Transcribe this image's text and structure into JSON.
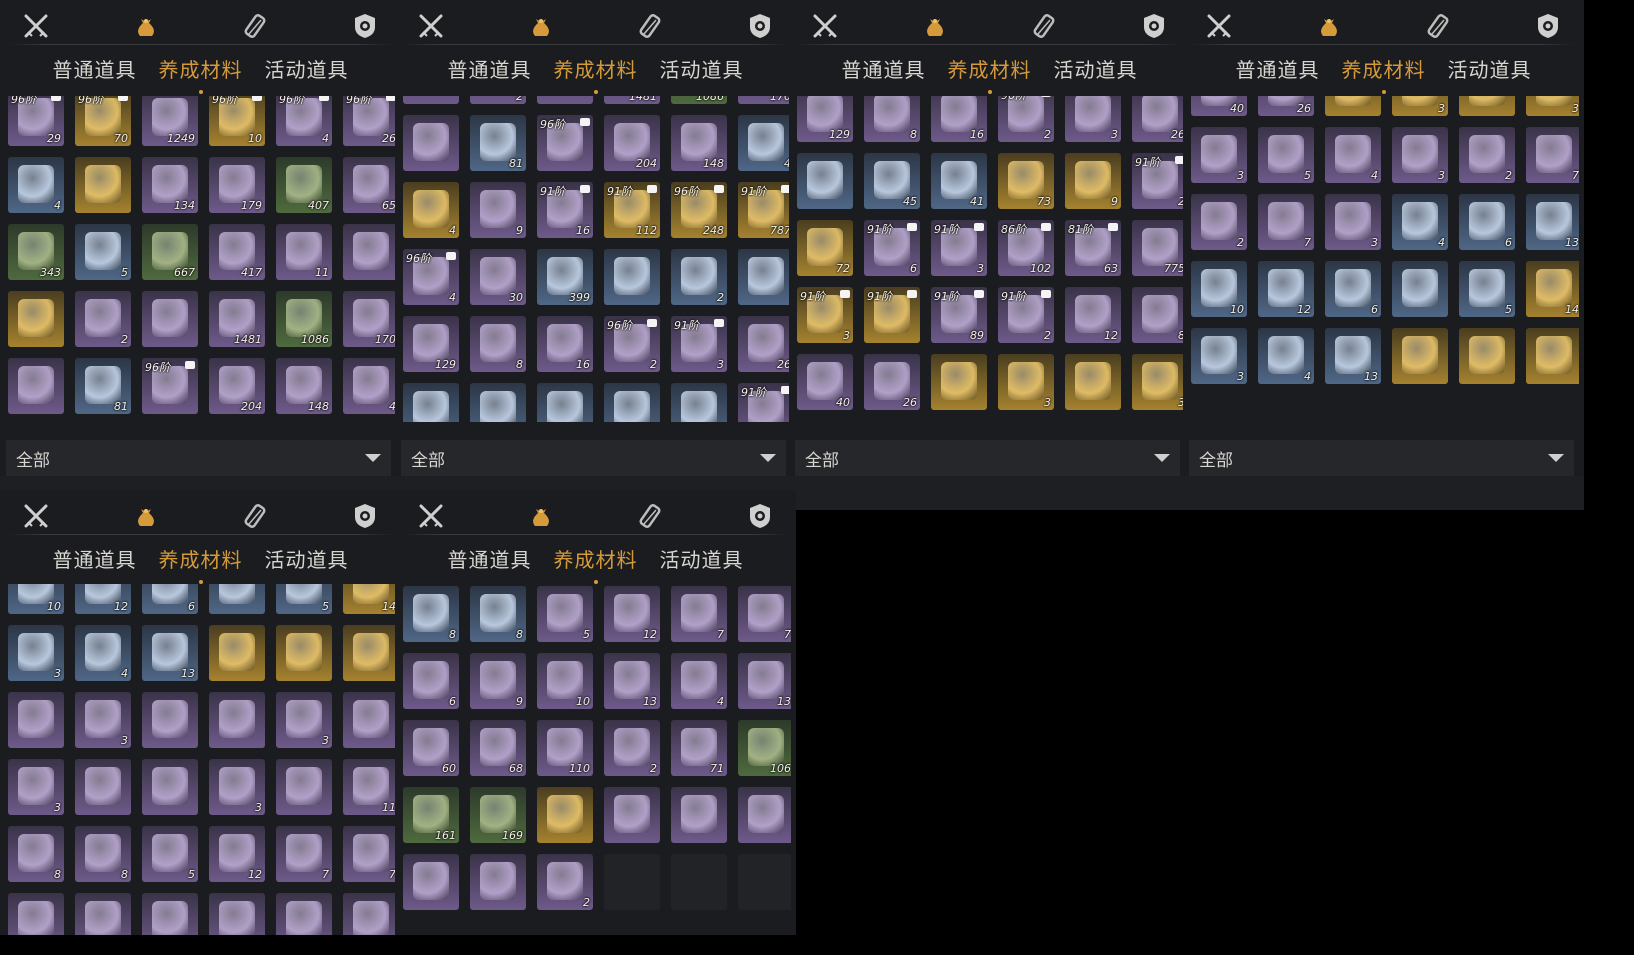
{
  "category_icons": [
    "swords-icon",
    "pouch-icon",
    "scroll-icon",
    "badge-icon"
  ],
  "subtabs": {
    "common": "普通道具",
    "cultivation": "养成材料",
    "event": "活动道具"
  },
  "filter": {
    "label": "全部"
  },
  "colors": {
    "accent": "#d59a3a",
    "panel": "#1b1c1f",
    "text": "#d8d6d0"
  },
  "panels": [
    {
      "rows": [
        [
          {
            "r": "purple",
            "t": "96阶",
            "c": "29"
          },
          {
            "r": "gold",
            "t": "96阶",
            "c": "70"
          },
          {
            "r": "purple",
            "c": "1249"
          },
          {
            "r": "gold",
            "t": "96阶",
            "c": "10"
          },
          {
            "r": "purple",
            "t": "96阶",
            "c": "4"
          },
          {
            "r": "purple",
            "t": "96阶",
            "c": "26"
          }
        ],
        [
          {
            "r": "blue",
            "c": "4"
          },
          {
            "r": "gold",
            "c": ""
          },
          {
            "r": "purple",
            "c": "134"
          },
          {
            "r": "purple",
            "c": "179"
          },
          {
            "r": "green",
            "c": "407"
          },
          {
            "r": "purple",
            "c": "65"
          }
        ],
        [
          {
            "r": "green",
            "c": "343"
          },
          {
            "r": "blue",
            "c": "5"
          },
          {
            "r": "green",
            "c": "667"
          },
          {
            "r": "purple",
            "c": "417"
          },
          {
            "r": "purple",
            "c": "11"
          },
          {
            "r": "purple",
            "c": ""
          }
        ],
        [
          {
            "r": "gold",
            "c": ""
          },
          {
            "r": "purple",
            "c": "2"
          },
          {
            "r": "purple",
            "c": ""
          },
          {
            "r": "purple",
            "c": "1481"
          },
          {
            "r": "green",
            "c": "1086"
          },
          {
            "r": "purple",
            "c": "170"
          }
        ],
        [
          {
            "r": "purple",
            "c": ""
          },
          {
            "r": "blue",
            "c": "81"
          },
          {
            "r": "purple",
            "t": "96阶",
            "c": ""
          },
          {
            "r": "purple",
            "c": "204"
          },
          {
            "r": "purple",
            "c": "148"
          },
          {
            "r": "purple",
            "c": "4"
          }
        ]
      ]
    },
    {
      "rows": [
        [
          {
            "r": "purple",
            "c": ""
          },
          {
            "r": "purple",
            "c": "2"
          },
          {
            "r": "purple",
            "c": ""
          },
          {
            "r": "purple",
            "c": "1481"
          },
          {
            "r": "green",
            "c": "1086"
          },
          {
            "r": "purple",
            "c": "170"
          }
        ],
        [
          {
            "r": "purple",
            "c": ""
          },
          {
            "r": "blue",
            "c": "81"
          },
          {
            "r": "purple",
            "t": "96阶",
            "c": ""
          },
          {
            "r": "purple",
            "c": "204"
          },
          {
            "r": "purple",
            "c": "148"
          },
          {
            "r": "blue",
            "c": "4"
          }
        ],
        [
          {
            "r": "gold",
            "c": "4"
          },
          {
            "r": "purple",
            "c": "9"
          },
          {
            "r": "purple",
            "t": "91阶",
            "c": "16"
          },
          {
            "r": "gold",
            "t": "91阶",
            "c": "112"
          },
          {
            "r": "gold",
            "t": "96阶",
            "c": "248"
          },
          {
            "r": "gold",
            "t": "91阶",
            "c": "787"
          }
        ],
        [
          {
            "r": "purple",
            "t": "96阶",
            "c": "4"
          },
          {
            "r": "purple",
            "c": "30"
          },
          {
            "r": "blue",
            "c": "399"
          },
          {
            "r": "blue",
            "c": ""
          },
          {
            "r": "blue",
            "c": "2"
          },
          {
            "r": "blue",
            "c": ""
          }
        ],
        [
          {
            "r": "purple",
            "c": "129"
          },
          {
            "r": "purple",
            "c": "8"
          },
          {
            "r": "purple",
            "c": "16"
          },
          {
            "r": "purple",
            "t": "96阶",
            "c": "2"
          },
          {
            "r": "purple",
            "t": "91阶",
            "c": "3"
          },
          {
            "r": "purple",
            "c": "26"
          }
        ],
        [
          {
            "r": "blue",
            "c": ""
          },
          {
            "r": "blue",
            "c": "45"
          },
          {
            "r": "blue",
            "c": "41"
          },
          {
            "r": "blue",
            "c": "73"
          },
          {
            "r": "blue",
            "c": "9"
          },
          {
            "r": "purple",
            "t": "91阶",
            "c": "2"
          }
        ]
      ]
    },
    {
      "rows": [
        [
          {
            "r": "purple",
            "c": "129"
          },
          {
            "r": "purple",
            "c": "8"
          },
          {
            "r": "purple",
            "c": "16"
          },
          {
            "r": "purple",
            "t": "96阶",
            "c": "2"
          },
          {
            "r": "purple",
            "c": "3"
          },
          {
            "r": "purple",
            "c": "26"
          }
        ],
        [
          {
            "r": "blue",
            "c": ""
          },
          {
            "r": "blue",
            "c": "45"
          },
          {
            "r": "blue",
            "c": "41"
          },
          {
            "r": "gold",
            "c": "73"
          },
          {
            "r": "gold",
            "c": "9"
          },
          {
            "r": "purple",
            "t": "91阶",
            "c": "2"
          }
        ],
        [
          {
            "r": "gold",
            "c": "72"
          },
          {
            "r": "purple",
            "t": "91阶",
            "c": "6"
          },
          {
            "r": "purple",
            "t": "91阶",
            "c": "3"
          },
          {
            "r": "purple",
            "t": "86阶",
            "c": "102"
          },
          {
            "r": "purple",
            "t": "81阶",
            "c": "63"
          },
          {
            "r": "purple",
            "c": "775"
          }
        ],
        [
          {
            "r": "gold",
            "t": "91阶",
            "c": "3"
          },
          {
            "r": "gold",
            "t": "91阶",
            "c": ""
          },
          {
            "r": "purple",
            "t": "91阶",
            "c": "89"
          },
          {
            "r": "purple",
            "t": "91阶",
            "c": "2"
          },
          {
            "r": "purple",
            "c": "12"
          },
          {
            "r": "purple",
            "c": "8"
          }
        ],
        [
          {
            "r": "purple",
            "c": "40"
          },
          {
            "r": "purple",
            "c": "26"
          },
          {
            "r": "gold",
            "c": ""
          },
          {
            "r": "gold",
            "c": "3"
          },
          {
            "r": "gold",
            "c": ""
          },
          {
            "r": "gold",
            "c": "3"
          }
        ]
      ]
    },
    {
      "rows": [
        [
          {
            "r": "purple",
            "c": "40"
          },
          {
            "r": "purple",
            "c": "26"
          },
          {
            "r": "gold",
            "c": ""
          },
          {
            "r": "gold",
            "c": "3"
          },
          {
            "r": "gold",
            "c": ""
          },
          {
            "r": "gold",
            "c": "3"
          }
        ],
        [
          {
            "r": "purple",
            "c": "3"
          },
          {
            "r": "purple",
            "c": "5"
          },
          {
            "r": "purple",
            "c": "4"
          },
          {
            "r": "purple",
            "c": "3"
          },
          {
            "r": "purple",
            "c": "2"
          },
          {
            "r": "purple",
            "c": "7"
          }
        ],
        [
          {
            "r": "purple",
            "c": "2"
          },
          {
            "r": "purple",
            "c": "7"
          },
          {
            "r": "purple",
            "c": "3"
          },
          {
            "r": "blue",
            "c": "4"
          },
          {
            "r": "blue",
            "c": "6"
          },
          {
            "r": "blue",
            "c": "13"
          }
        ],
        [
          {
            "r": "blue",
            "c": "10"
          },
          {
            "r": "blue",
            "c": "12"
          },
          {
            "r": "blue",
            "c": "6"
          },
          {
            "r": "blue",
            "c": ""
          },
          {
            "r": "blue",
            "c": "5"
          },
          {
            "r": "gold",
            "c": "14"
          }
        ],
        [
          {
            "r": "blue",
            "c": "3"
          },
          {
            "r": "blue",
            "c": "4"
          },
          {
            "r": "blue",
            "c": "13"
          },
          {
            "r": "gold",
            "c": ""
          },
          {
            "r": "gold",
            "c": ""
          },
          {
            "r": "gold",
            "c": ""
          }
        ]
      ]
    },
    {
      "rows": [
        [
          {
            "r": "blue",
            "c": "10"
          },
          {
            "r": "blue",
            "c": "12"
          },
          {
            "r": "blue",
            "c": "6"
          },
          {
            "r": "blue",
            "c": ""
          },
          {
            "r": "blue",
            "c": "5"
          },
          {
            "r": "gold",
            "c": "14"
          }
        ],
        [
          {
            "r": "blue",
            "c": "3"
          },
          {
            "r": "blue",
            "c": "4"
          },
          {
            "r": "blue",
            "c": "13"
          },
          {
            "r": "gold",
            "c": ""
          },
          {
            "r": "gold",
            "c": ""
          },
          {
            "r": "gold",
            "c": ""
          }
        ],
        [
          {
            "r": "purple",
            "c": ""
          },
          {
            "r": "purple",
            "c": "3"
          },
          {
            "r": "purple",
            "c": ""
          },
          {
            "r": "purple",
            "c": ""
          },
          {
            "r": "purple",
            "c": "3"
          },
          {
            "r": "purple",
            "c": ""
          }
        ],
        [
          {
            "r": "purple",
            "c": "3"
          },
          {
            "r": "purple",
            "c": ""
          },
          {
            "r": "purple",
            "c": ""
          },
          {
            "r": "purple",
            "c": "3"
          },
          {
            "r": "purple",
            "c": ""
          },
          {
            "r": "purple",
            "c": "11"
          }
        ],
        [
          {
            "r": "purple",
            "c": "8"
          },
          {
            "r": "purple",
            "c": "8"
          },
          {
            "r": "purple",
            "c": "5"
          },
          {
            "r": "purple",
            "c": "12"
          },
          {
            "r": "purple",
            "c": "7"
          },
          {
            "r": "purple",
            "c": "7"
          }
        ],
        [
          {
            "r": "purple",
            "c": ""
          },
          {
            "r": "purple",
            "c": ""
          },
          {
            "r": "purple",
            "c": ""
          },
          {
            "r": "purple",
            "c": ""
          },
          {
            "r": "purple",
            "c": ""
          },
          {
            "r": "purple",
            "c": ""
          }
        ]
      ]
    },
    {
      "rows": [
        [
          {
            "r": "blue",
            "c": "8"
          },
          {
            "r": "blue",
            "c": "8"
          },
          {
            "r": "purple",
            "c": "5"
          },
          {
            "r": "purple",
            "c": "12"
          },
          {
            "r": "purple",
            "c": "7"
          },
          {
            "r": "purple",
            "c": "7"
          }
        ],
        [
          {
            "r": "purple",
            "c": "6"
          },
          {
            "r": "purple",
            "c": "9"
          },
          {
            "r": "purple",
            "c": "10"
          },
          {
            "r": "purple",
            "c": "13"
          },
          {
            "r": "purple",
            "c": "4"
          },
          {
            "r": "purple",
            "c": "13"
          }
        ],
        [
          {
            "r": "purple",
            "c": "60"
          },
          {
            "r": "purple",
            "c": "68"
          },
          {
            "r": "purple",
            "c": "110"
          },
          {
            "r": "purple",
            "c": "2"
          },
          {
            "r": "purple",
            "c": "71"
          },
          {
            "r": "green",
            "c": "106"
          }
        ],
        [
          {
            "r": "green",
            "c": "161"
          },
          {
            "r": "green",
            "c": "169"
          },
          {
            "r": "gold",
            "c": ""
          },
          {
            "r": "purple",
            "c": ""
          },
          {
            "r": "purple",
            "c": ""
          },
          {
            "r": "purple",
            "c": ""
          }
        ],
        [
          {
            "r": "purple",
            "c": ""
          },
          {
            "r": "purple",
            "c": ""
          },
          {
            "r": "purple",
            "c": "2"
          },
          {
            "r": "empty",
            "c": ""
          },
          {
            "r": "empty",
            "c": ""
          },
          {
            "r": "empty",
            "c": ""
          }
        ]
      ]
    }
  ]
}
